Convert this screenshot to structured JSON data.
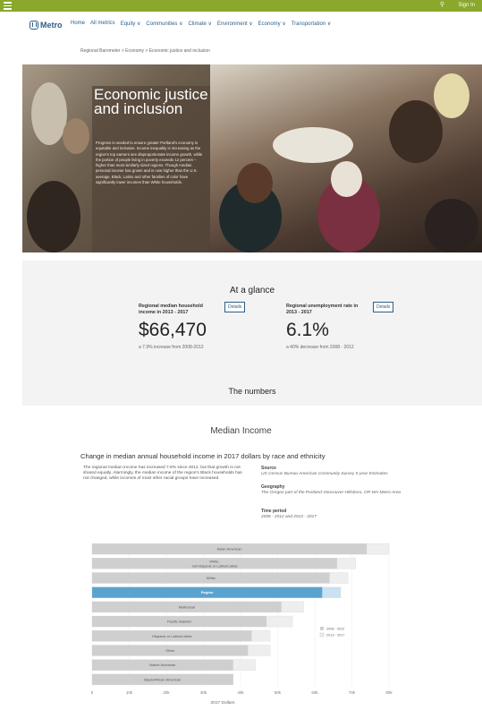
{
  "topbar": {
    "search_icon": "search-icon",
    "sign_in": "Sign In",
    "color": "#8aa82c"
  },
  "logo": {
    "text": "Metro",
    "color": "#2b5f8a"
  },
  "nav": {
    "items": [
      "Home",
      "All metrics",
      "Equity ∨",
      "Communities ∨",
      "Climate ∨",
      "Environment ∨",
      "Economy ∨",
      "Transportation ∨"
    ]
  },
  "breadcrumb": "Regional Barometer > Economy > Economic justice and inclusion",
  "hero": {
    "title": "Economic justice and inclusion",
    "description": "Progress is needed to ensure greater Portland's economy is equitable and inclusive. Income inequality is increasing as the region's top earners see disproportionate income growth, while the portion of people living in poverty exceeds 12 percent – higher than most similarly sized regions. Though median personal income has grown and is now higher than the U.S. average, Black, Latinx and other families of color have significantly lower incomes than White households."
  },
  "glance": {
    "title": "At a glance",
    "stats": [
      {
        "label": "Regional median household income in 2013 - 2017",
        "value": "$66,470",
        "change": "a 7.9% increase from 2008-2012",
        "button": "Details"
      },
      {
        "label": "Regional unemployment rate in 2013 - 2017",
        "value": "6.1%",
        "change": "a 40% decrease from 2008 - 2012",
        "button": "Details"
      }
    ],
    "numbers_title": "The numbers"
  },
  "median_income": {
    "section_title": "Median Income",
    "chart_heading": "Change in median annual household income in 2017 dollars by race and ethnicity",
    "description": "The regional median income has increased 7.9% since 2012, but that growth is not shared equally. Alarmingly, the median income of the region's Black households has not changed, while incomes of most other racial groups have increased.",
    "source_label": "Source",
    "source_value": "US Census Bureau American Community Survey 5-year Estimates",
    "geography_label": "Geography",
    "geography_value": "The Oregon part of the Portland-Vancouver-Hillsboro, OR-WA Metro Area",
    "period_label": "Time period",
    "period_value": "2008 - 2012 and 2013 - 2017"
  },
  "chart_data": {
    "type": "bar",
    "categories": [
      "Asian American",
      "White, not Hispanic or Latino/Latina",
      "White",
      "Region",
      "Multiracial",
      "Pacific Islander",
      "Hispanic or Latino/Latina",
      "Other",
      "Native American",
      "Black/African American"
    ],
    "series": [
      {
        "name": "2008 - 2012",
        "values": [
          80000,
          66000,
          64000,
          62000,
          51000,
          47000,
          43000,
          42000,
          38000,
          38000
        ]
      },
      {
        "name": "2013 - 2017",
        "values": [
          74000,
          71000,
          69000,
          67000,
          57000,
          54000,
          48000,
          48000,
          44000,
          38000
        ]
      }
    ],
    "highlight": "Region",
    "xlabel": "2017 Dollars",
    "xticks": [
      "0",
      "10k",
      "20k",
      "30k",
      "40k",
      "50k",
      "60k",
      "70k",
      "80k"
    ],
    "xlim": [
      0,
      80000
    ],
    "colors": {
      "bar": "#cfcfcf",
      "bar_back": "#eeeeee",
      "highlight": "#5ba3cf",
      "highlight_back": "#c9e1f1"
    },
    "legend_position": "right"
  }
}
